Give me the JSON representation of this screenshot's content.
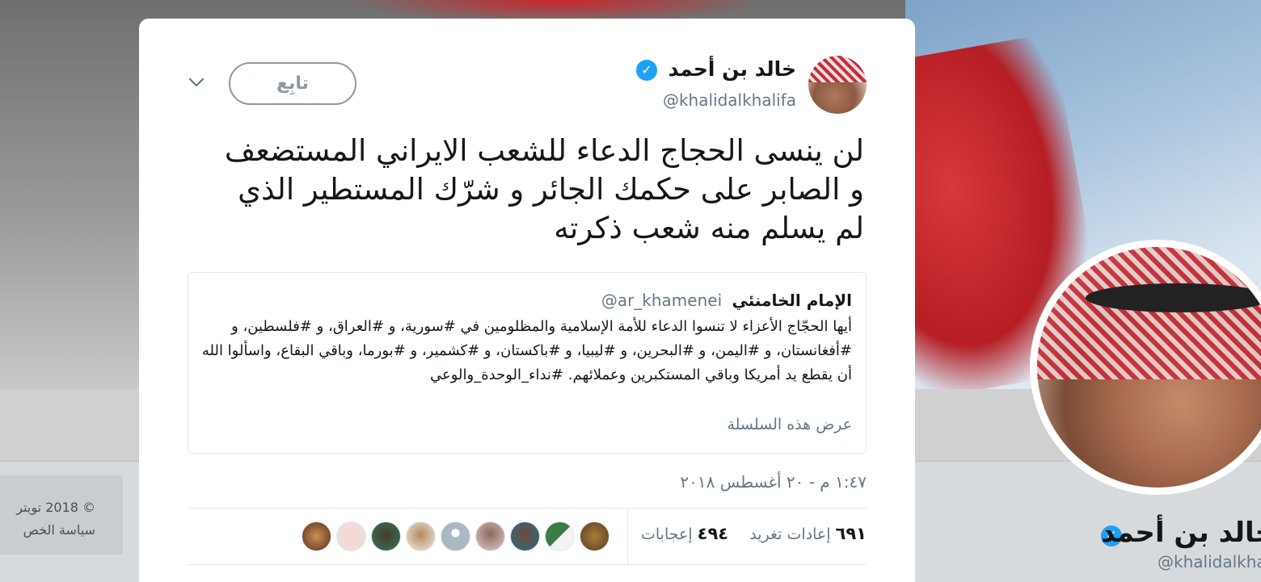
{
  "background_profile": {
    "display_name": "خالد بن أحمد",
    "handle": "@khalidalkhali",
    "footer": {
      "copyright": "© 2018 تويتر",
      "privacy": "سياسة الخص"
    }
  },
  "tweet": {
    "author": {
      "display_name": "خالد بن أحمد",
      "handle": "@khalidalkhalifa",
      "verified_icon": "verified-badge-icon"
    },
    "follow_button_label": "تابِع",
    "text": "لن ينسى الحجاج الدعاء للشعب الايراني المستضعف و الصابر على حكمك الجائر و شرّك المستطير الذي لم يسلم منه شعب ذكرته",
    "quoted": {
      "name": "الإمام الخامنئي",
      "handle": "@ar_khamenei",
      "text": "أيها الحجّاج الأعزاء لا تنسوا الدعاء للأمة الإسلامية والمظلومين في #سورية، و #العراق، و #فلسطين، و #أفغانستان، و #اليمن، و #البحرين، و #ليبيا، و #باكستان، و #كشمير، و #بورما، وباقي البقاع، واسألوا الله أن يقطع يد أمريكا وباقي المستكبرين وعملائهم. #نداء_الوحدة_والوعي",
      "show_thread": "عرض هذه السلسلة"
    },
    "timestamp": "١:٤٧ م - ٢٠ أغسطس ٢٠١٨",
    "retweets": {
      "count": "٦٩١",
      "label": "إعادات تغريد"
    },
    "likes": {
      "count": "٤٩٤",
      "label": "إعجابات"
    }
  },
  "colors": {
    "accent": "#1da1f2",
    "secondary_text": "#657786",
    "primary_text": "#14171a"
  }
}
